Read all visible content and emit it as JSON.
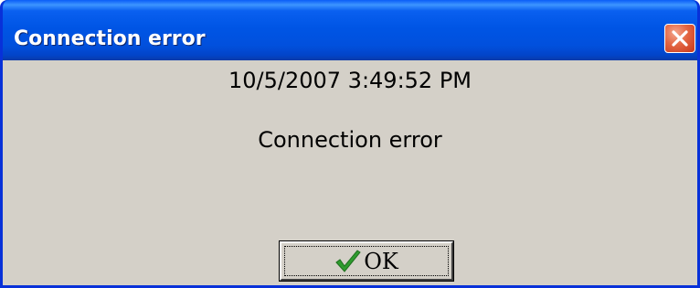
{
  "window": {
    "title": "Connection error",
    "close_icon": "close-icon"
  },
  "content": {
    "timestamp": "10/5/2007 3:49:52 PM",
    "message": "Connection error"
  },
  "buttons": {
    "ok_label": "OK",
    "ok_icon": "checkmark-icon"
  },
  "colors": {
    "titlebar": "#0054e3",
    "client_bg": "#d4d0c8",
    "close_button": "#e36643",
    "checkmark": "#2e9b2e"
  }
}
